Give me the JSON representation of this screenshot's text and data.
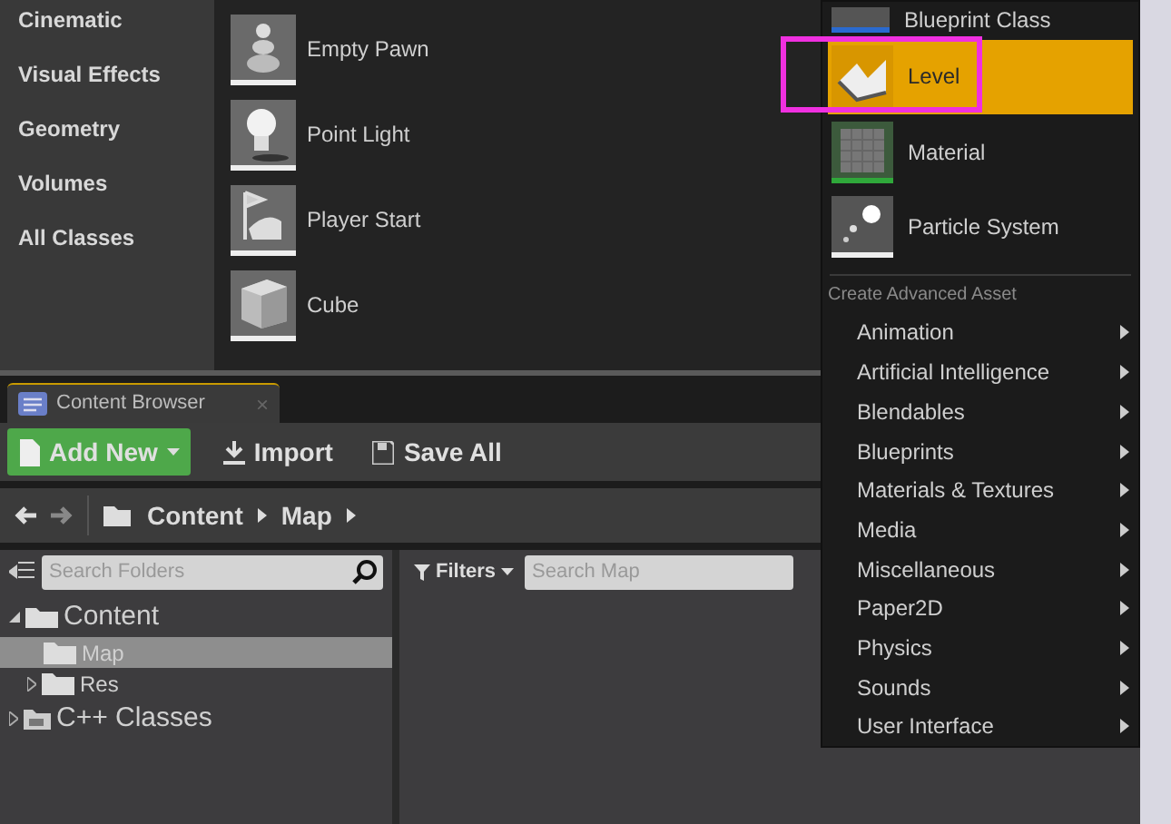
{
  "place_panel": {
    "categories": [
      {
        "label": "Cinematic"
      },
      {
        "label": "Visual Effects"
      },
      {
        "label": "Geometry"
      },
      {
        "label": "Volumes"
      },
      {
        "label": "All Classes"
      }
    ],
    "items": [
      {
        "label": "Empty Pawn",
        "kind": "pawn"
      },
      {
        "label": "Point Light",
        "kind": "light"
      },
      {
        "label": "Player Start",
        "kind": "start"
      },
      {
        "label": "Cube",
        "kind": "cube"
      }
    ]
  },
  "new_asset_menu": {
    "basic_assets": [
      {
        "label": "Blueprint Class",
        "kind": "blueprint",
        "selected": false
      },
      {
        "label": "Level",
        "kind": "level",
        "selected": true
      },
      {
        "label": "Material",
        "kind": "material",
        "selected": false
      },
      {
        "label": "Particle System",
        "kind": "particle",
        "selected": false
      }
    ],
    "section_header": "Create Advanced Asset",
    "submenus": [
      {
        "label": "Animation"
      },
      {
        "label": "Artificial Intelligence"
      },
      {
        "label": "Blendables"
      },
      {
        "label": "Blueprints"
      },
      {
        "label": "Materials & Textures"
      },
      {
        "label": "Media"
      },
      {
        "label": "Miscellaneous"
      },
      {
        "label": "Paper2D"
      },
      {
        "label": "Physics"
      },
      {
        "label": "Sounds"
      },
      {
        "label": "User Interface"
      }
    ]
  },
  "content_browser": {
    "tab": {
      "title": "Content Browser",
      "close": "×"
    },
    "toolbar": [
      {
        "label": "Add New",
        "kind": "add"
      },
      {
        "label": "Import",
        "kind": "import"
      },
      {
        "label": "Save All",
        "kind": "save"
      }
    ],
    "path": [
      "Content",
      "Map"
    ],
    "folder_search": {
      "placeholder": "Search Folders"
    },
    "filters": "Filters",
    "asset_search": {
      "placeholder": "Search Map"
    },
    "tree": [
      {
        "label": "Content",
        "expanded": true,
        "selected": false,
        "children": [
          {
            "label": "Map",
            "selected": true
          },
          {
            "label": "Res",
            "expanded": false,
            "selected": false
          }
        ]
      },
      {
        "label": "C++ Classes",
        "kind": "code",
        "expanded": false,
        "selected": false
      }
    ]
  }
}
